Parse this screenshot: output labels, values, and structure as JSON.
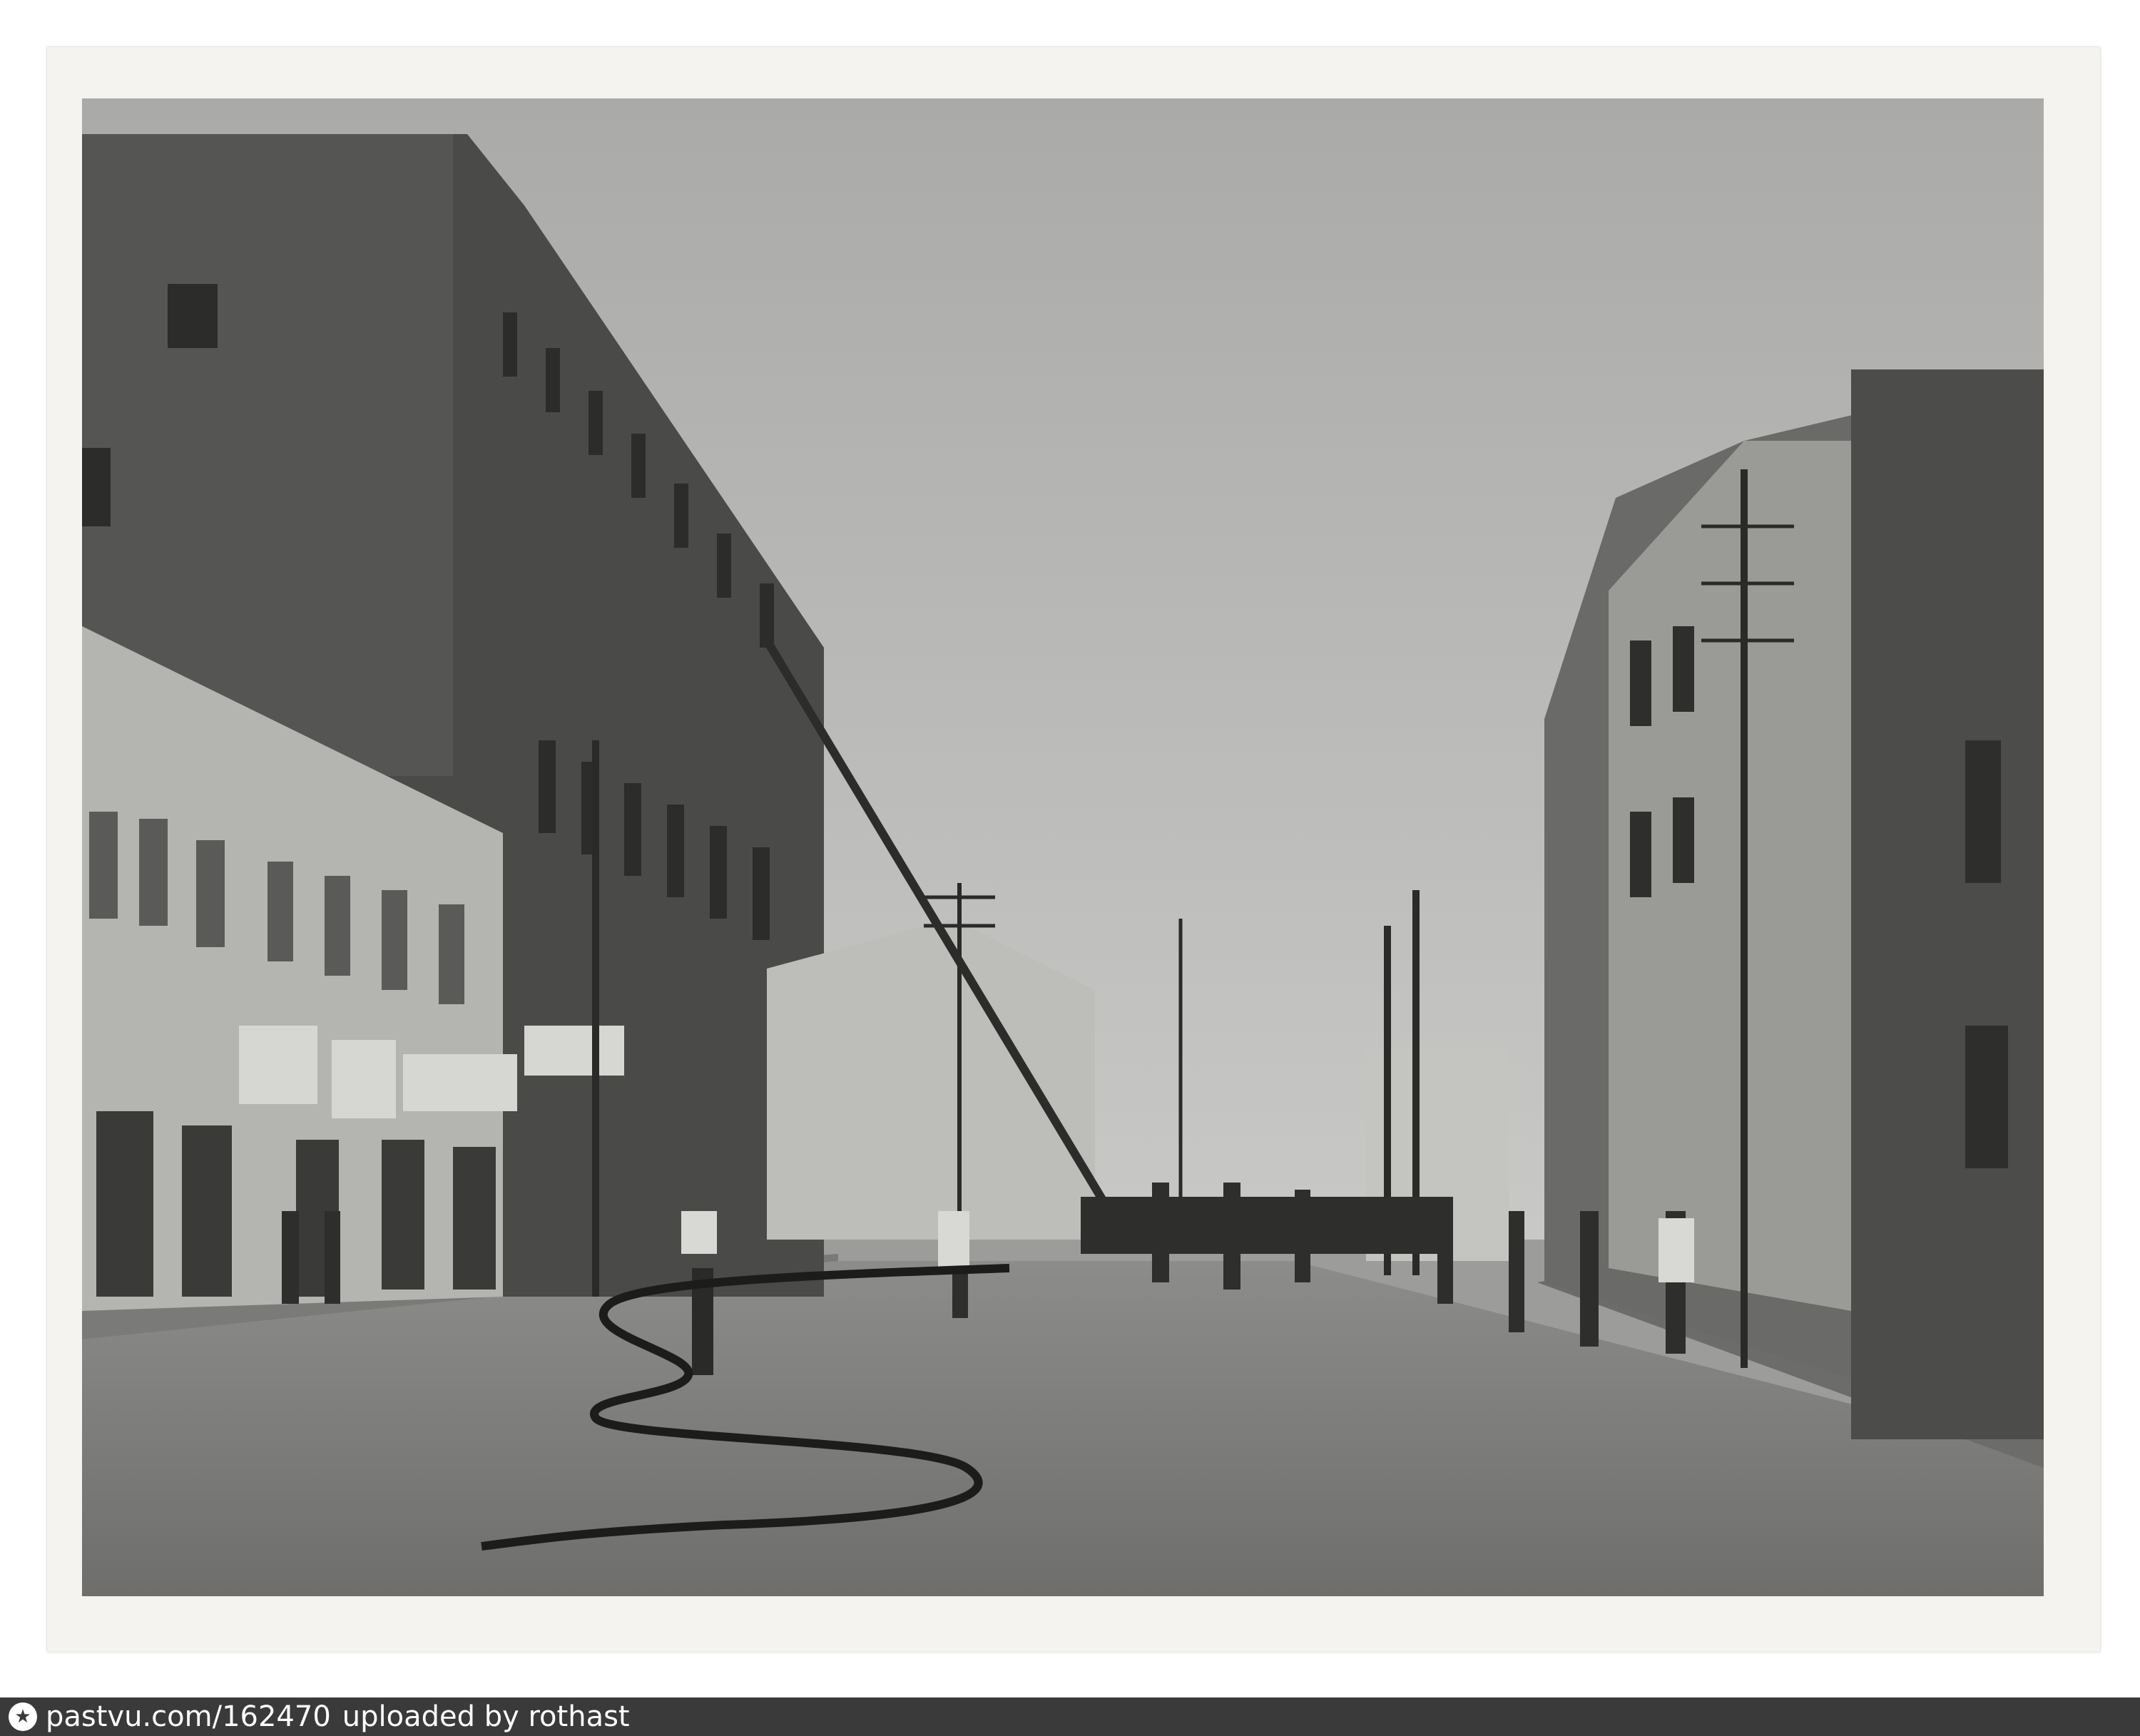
{
  "image": {
    "alt": "Black-and-white archival photograph of a city street with a long fire ladder leaning against a burned multi-storey building, a fire hose snaking across the wet pavement and pedestrians walking down the street.",
    "style": "monochrome"
  },
  "watermark": {
    "source_url": "pastvu.com/162470",
    "uploader_text": "uploaded by rothast",
    "logo_glyph": "★",
    "logo_icon": "star-circle-icon"
  },
  "colors": {
    "mat": "#f4f3ef",
    "bar": "#3a3a3a",
    "bar_text": "#ffffff"
  }
}
